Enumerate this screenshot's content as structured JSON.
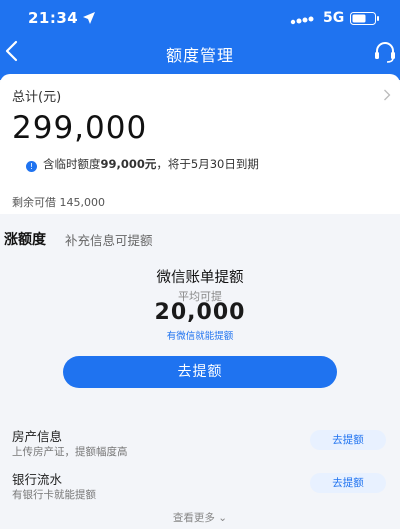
{
  "status_bar": {
    "time": "21:34",
    "network": "5G"
  },
  "nav": {
    "title": "额度管理"
  },
  "summary": {
    "total_label": "总计(元)",
    "total_amount": "299,000",
    "temp_prefix": "含临时额度",
    "temp_amount": "99,000元",
    "temp_suffix": "，将于5月30日到期",
    "remaining": "剩余可借 145,000"
  },
  "raise": {
    "title": "涨额度",
    "subtitle": "补充信息可提额"
  },
  "featured": {
    "title": "微信账单提额",
    "subtitle": "平均可提",
    "amount": "20,000",
    "note": "有微信就能提额",
    "button": "去提额"
  },
  "items": [
    {
      "title": "房产信息",
      "subtitle": "上传房产证，提额幅度高",
      "button": "去提额"
    },
    {
      "title": "银行流水",
      "subtitle": "有银行卡就能提额",
      "button": "去提额"
    }
  ],
  "more": "查看更多"
}
